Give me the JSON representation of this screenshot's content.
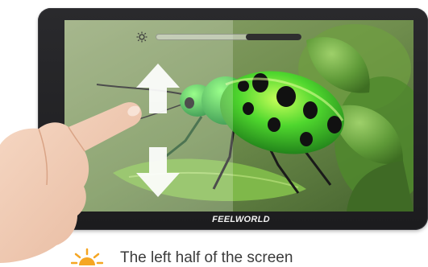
{
  "device": {
    "brand": "FEELWORLD"
  },
  "screen": {
    "subject": "green-jewel-beetle-on-leaf",
    "brightness_control": {
      "icon": "sun-icon",
      "level": 0.62
    },
    "gesture_arrows": {
      "icon": "up-down-arrow-icon"
    }
  },
  "caption": {
    "icon": "sun-icon",
    "text": "The left half of the screen"
  },
  "colors": {
    "bezel": "#1e1e20",
    "caption_sun": "#f5a623",
    "beetle_green": "#2fbf2a",
    "caption_text": "#3b3b3b"
  }
}
